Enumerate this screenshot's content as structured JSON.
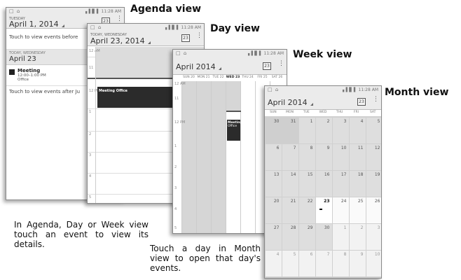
{
  "status_time": "11:28 AM",
  "status_signal": "▖▌▊",
  "status_battery": "▌",
  "status_left": "□ ⌂",
  "cal_icon": "23",
  "labels": {
    "agenda": "Agenda view",
    "day": "Day view",
    "week": "Week view",
    "month": "Month view"
  },
  "captions": {
    "agenda": "In Agenda, Day or Week view touch an event to view its details.",
    "month": "Touch a day in Month view to open that day's events."
  },
  "agenda": {
    "top_small": "TUESDAY",
    "top_date": "April 1, 2014",
    "touch_before": "Touch to view events before",
    "sub_small": "TODAY, WEDNESDAY",
    "sub_date": "April 23",
    "event_title": "Meeting",
    "event_time": "12:00–1:00 PM",
    "event_place": "Office",
    "touch_after": "Touch to view events after Ju"
  },
  "day": {
    "top_small": "TODAY, WEDNESDAY",
    "top_date": "April 23, 2014",
    "event": "Meeting Office",
    "hours": [
      "11",
      "12 PM",
      "1",
      "2",
      "3",
      "4",
      "5"
    ],
    "allday": "12 AM"
  },
  "week": {
    "month": "April 2014",
    "days": [
      "SUN 20",
      "MON 21",
      "TUE 22",
      "WED 23",
      "THU 24",
      "FRI 25",
      "SAT 26"
    ],
    "hours": [
      "11",
      "12 PM",
      "1",
      "2",
      "3",
      "4",
      "5"
    ],
    "allday": "12 AM",
    "event_title": "Meeting",
    "event_place": "Office"
  },
  "month": {
    "title": "April 2014",
    "dows": [
      "SUN",
      "MON",
      "TUE",
      "WED",
      "THU",
      "FRI",
      "SAT"
    ],
    "weeks": [
      [
        "30",
        "31",
        "1",
        "2",
        "3",
        "4",
        "5"
      ],
      [
        "6",
        "7",
        "8",
        "9",
        "10",
        "11",
        "12"
      ],
      [
        "13",
        "14",
        "15",
        "16",
        "17",
        "18",
        "19"
      ],
      [
        "20",
        "21",
        "22",
        "23",
        "24",
        "25",
        "26"
      ],
      [
        "27",
        "28",
        "29",
        "30",
        "1",
        "2",
        "3"
      ],
      [
        "4",
        "5",
        "6",
        "7",
        "8",
        "9",
        "10"
      ]
    ]
  }
}
